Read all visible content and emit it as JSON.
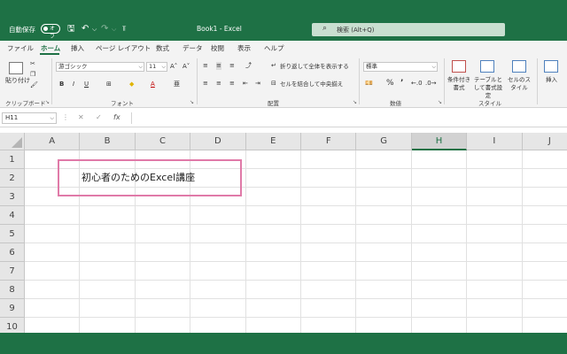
{
  "titlebar": {
    "autosave_label": "自動保存",
    "toggle_label": "オフ",
    "doc_title": "Book1 - Excel",
    "search_placeholder": "検索 (Alt+Q)"
  },
  "tabs": [
    {
      "label": "ファイル",
      "active": false
    },
    {
      "label": "ホーム",
      "active": true
    },
    {
      "label": "挿入",
      "active": false
    },
    {
      "label": "ページ レイアウト",
      "active": false
    },
    {
      "label": "数式",
      "active": false
    },
    {
      "label": "データ",
      "active": false
    },
    {
      "label": "校閲",
      "active": false
    },
    {
      "label": "表示",
      "active": false
    },
    {
      "label": "ヘルプ",
      "active": false
    }
  ],
  "ribbon": {
    "clipboard": {
      "paste_label": "貼り付け",
      "group_label": "クリップボード"
    },
    "font": {
      "font_name": "游ゴシック",
      "font_size": "11",
      "group_label": "フォント",
      "bold": "B",
      "italic": "I",
      "underline": "U"
    },
    "alignment": {
      "wrap_label": "折り返して全体を表示する",
      "merge_label": "セルを結合して中央揃え",
      "group_label": "配置"
    },
    "number": {
      "format": "標準",
      "group_label": "数値"
    },
    "styles": {
      "conditional_label": "条件付き書式",
      "table_label": "テーブルとして書式設定",
      "cell_style_label": "セルのスタイル",
      "group_label": "スタイル"
    },
    "cells": {
      "insert_label": "挿入"
    }
  },
  "formula_bar": {
    "name_box": "H11",
    "fx": "fx",
    "value": ""
  },
  "grid": {
    "columns": [
      "A",
      "B",
      "C",
      "D",
      "E",
      "F",
      "G",
      "H",
      "I",
      "J"
    ],
    "selected_column": "H",
    "rows": [
      "1",
      "2",
      "3",
      "4",
      "5",
      "6",
      "7",
      "8",
      "9",
      "10"
    ],
    "cell_B2": "初心者のためのExcel講座"
  },
  "colors": {
    "brand": "#1e7145",
    "highlight": "#e07aa8"
  }
}
